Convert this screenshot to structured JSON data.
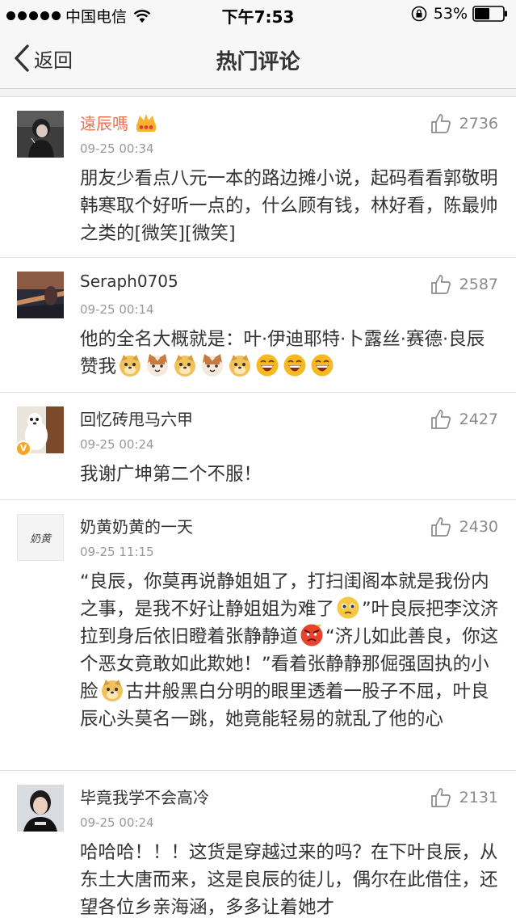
{
  "status_bar": {
    "carrier": "中国电信",
    "time": "下午7:53",
    "battery_percent": "53%",
    "battery_level": 0.53,
    "icons": [
      "signal-dots-icon",
      "wifi-icon",
      "rotation-lock-icon",
      "battery-icon"
    ]
  },
  "nav": {
    "back_label": "返回",
    "title": "热门评论",
    "icons": [
      "chevron-left-icon"
    ]
  },
  "comments": [
    {
      "username": "遠辰嗎",
      "badge_icon": "crown-icon",
      "time": "09-25 00:34",
      "likes": "2736",
      "text": "朋友少看点八元一本的路边摊小说，起码看看郭敬明韩寒取个好听一点的，什么顾有钱，林好看，陈最帅之类的[微笑][微笑]"
    },
    {
      "username": "Seraph0705",
      "time": "09-25 00:14",
      "likes": "2587",
      "text": "他的全名大概就是：叶·伊迪耶特·卜露丝·赛德·良辰　 赞我",
      "emoticons": [
        "doge-icon",
        "cat-icon",
        "doge-icon",
        "cat-icon",
        "doge-icon",
        "laugh-icon",
        "laugh-icon",
        "laugh-icon"
      ]
    },
    {
      "username": "回忆砖甩马六甲",
      "verified": "V",
      "time": "09-25 00:24",
      "likes": "2427",
      "text": "我谢广坤第二个不服！"
    },
    {
      "username": "奶黄奶黄的一天",
      "time": "09-25 11:15",
      "likes": "2430",
      "avatar_text": "奶黄",
      "text_parts": [
        "“良辰，你莫再说静姐姐了，打扫闺阁本就是我份内之事，是我不好让静姐姐为难了",
        "”叶良辰把李汶济拉到身后依旧瞪着张静静道",
        "“济儿如此善良，你这个恶女竟敢如此欺她！”看着张静静那倔强固执的小脸",
        "古井般黑白分明的眼里透着一股子不屈，叶良辰心头莫名一跳，她竟能轻易的就乱了他的心"
      ],
      "emoticons": [
        "pitiful-icon",
        "angry-icon",
        "doge-icon"
      ]
    },
    {
      "username": "毕竟我学不会高冷",
      "time": "09-25 00:24",
      "likes": "2131",
      "text": "哈哈哈！！！这货是穿越过来的吗？在下叶良辰，从东土大唐而来，这是良辰的徒儿，偶尔在此借住，还望各位乡亲海涵，多多让着她才"
    }
  ],
  "colors": {
    "vip_name": "#eb7350",
    "meta_gray": "#999999",
    "badge_orange": "#f5a623",
    "bar_bg": "#f7f7f7"
  }
}
